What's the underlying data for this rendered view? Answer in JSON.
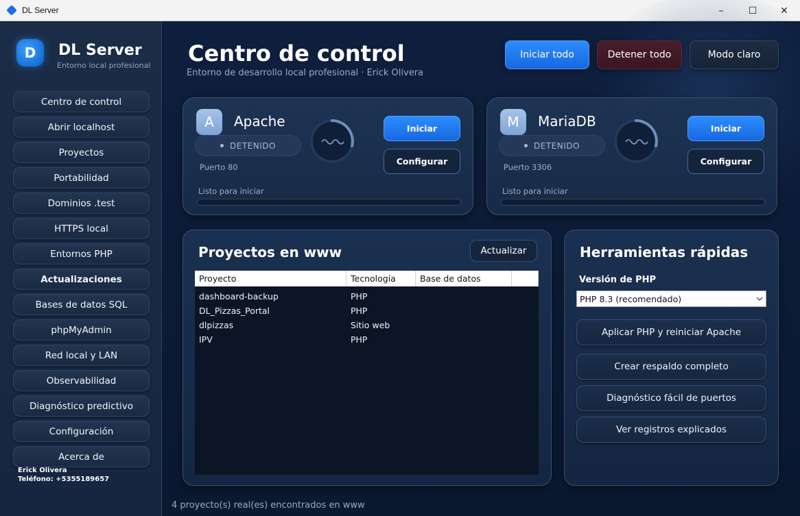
{
  "window": {
    "title": "DL Server",
    "minimize": "–",
    "maximize": "☐",
    "close": "✕"
  },
  "sidebar": {
    "logo_letter": "D",
    "brand": "DL Server",
    "brand_sub": "Entorno local profesional",
    "items": [
      {
        "label": "Centro de control"
      },
      {
        "label": "Abrir localhost"
      },
      {
        "label": "Proyectos"
      },
      {
        "label": "Portabilidad"
      },
      {
        "label": "Dominios .test"
      },
      {
        "label": "HTTPS local"
      },
      {
        "label": "Entornos PHP"
      },
      {
        "label": "Actualizaciones"
      },
      {
        "label": "Bases de datos SQL"
      },
      {
        "label": "phpMyAdmin"
      },
      {
        "label": "Red local y LAN"
      },
      {
        "label": "Observabilidad"
      },
      {
        "label": "Diagnóstico predictivo"
      },
      {
        "label": "Configuración"
      },
      {
        "label": "Acerca de"
      }
    ],
    "author_name": "Erick Olivera",
    "author_phone": "Teléfono: +5355189657"
  },
  "header": {
    "title": "Centro de control",
    "subtitle": "Entorno de desarrollo local profesional · Erick Olivera",
    "start_all": "Iniciar todo",
    "stop_all": "Detener todo",
    "light_mode": "Modo claro"
  },
  "services": [
    {
      "letter": "A",
      "name": "Apache",
      "status": "DETENIDO",
      "port": "Puerto 80",
      "start": "Iniciar",
      "configure": "Configurar",
      "ready": "Listo para iniciar",
      "progress": 0
    },
    {
      "letter": "M",
      "name": "MariaDB",
      "status": "DETENIDO",
      "port": "Puerto 3306",
      "start": "Iniciar",
      "configure": "Configurar",
      "ready": "Listo para iniciar",
      "progress": 0
    }
  ],
  "projects": {
    "title": "Proyectos en www",
    "refresh": "Actualizar",
    "columns": [
      "Proyecto",
      "Tecnología",
      "Base de datos"
    ],
    "rows": [
      {
        "name": "dashboard-backup",
        "tech": "PHP",
        "db": ""
      },
      {
        "name": "DL_Pizzas_Portal",
        "tech": "PHP",
        "db": ""
      },
      {
        "name": "dlpizzas",
        "tech": "Sitio web",
        "db": ""
      },
      {
        "name": "IPV",
        "tech": "PHP",
        "db": ""
      }
    ]
  },
  "tools": {
    "title": "Herramientas rápidas",
    "php_label": "Versión de PHP",
    "php_selected": "PHP 8.3 (recomendado)",
    "apply_php": "Aplicar PHP y reiniciar Apache",
    "backup": "Crear respaldo completo",
    "ports": "Diagnóstico fácil de puertos",
    "logs": "Ver registros explicados"
  },
  "footer": {
    "status": "4 proyecto(s) real(es) encontrados en www"
  },
  "colors": {
    "accent": "#2e8cff",
    "danger": "#4a1d2c",
    "background": "#0b1a33"
  }
}
